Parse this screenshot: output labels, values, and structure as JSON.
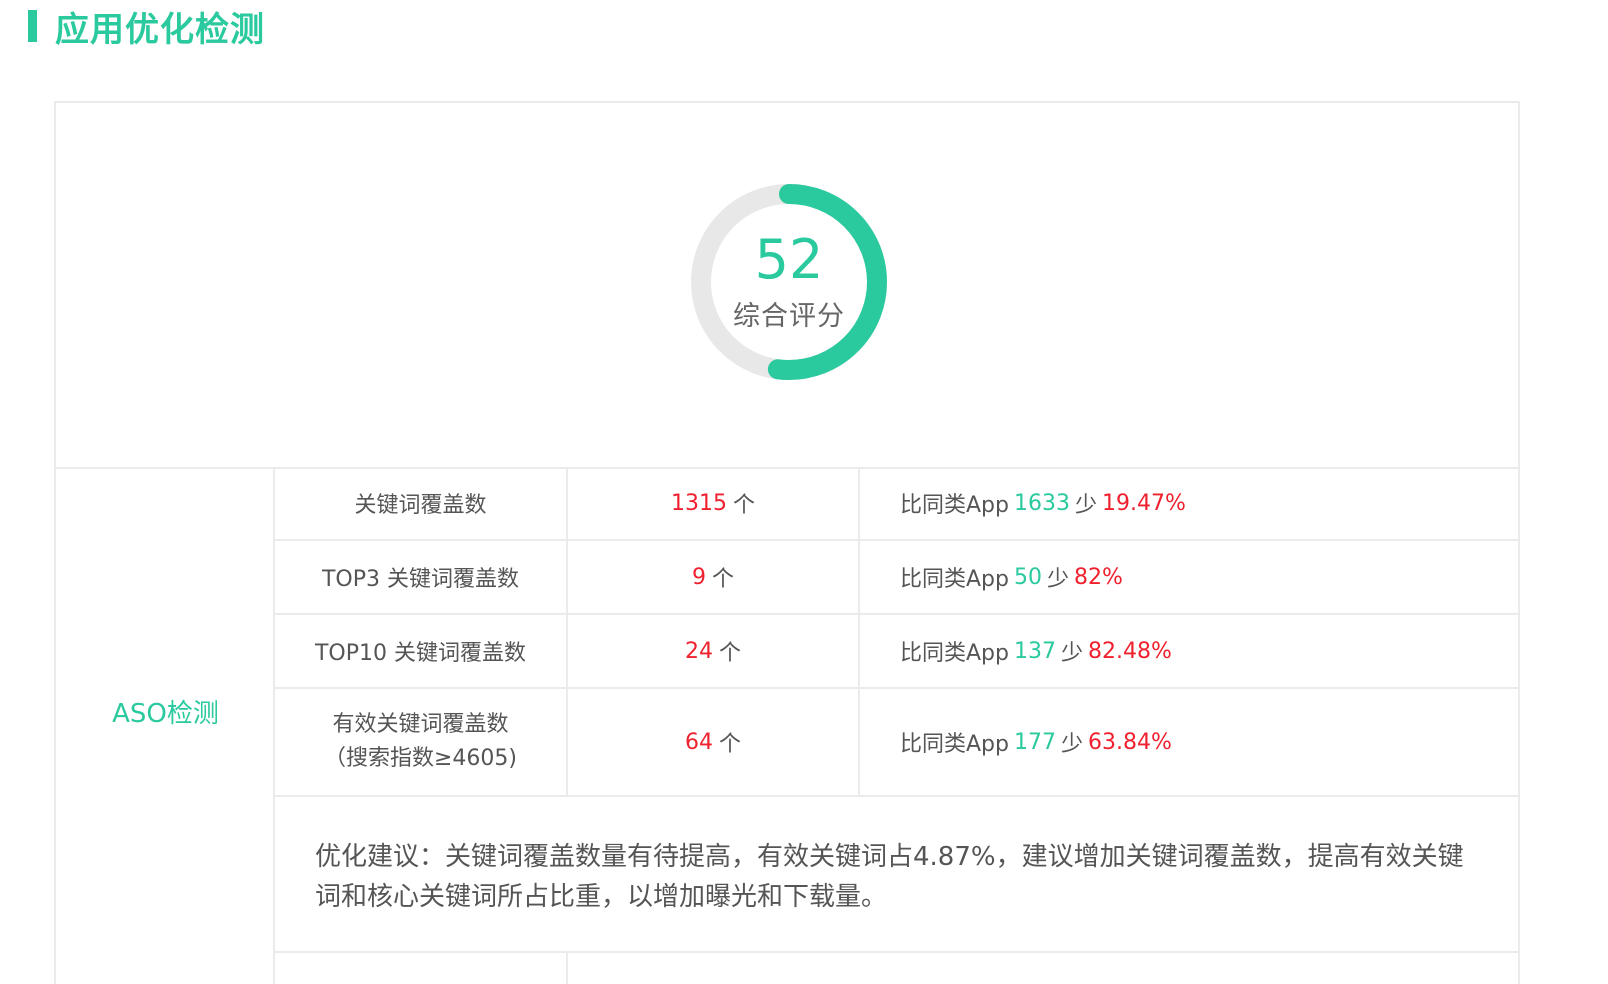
{
  "section": {
    "title": "应用优化检测",
    "accent_color": "#2ac99e"
  },
  "score": {
    "value": "52",
    "label": "综合评分",
    "fraction": 0.52,
    "track_color": "#e8e8e8",
    "fill_color": "#2ac99e"
  },
  "aso": {
    "label": "ASO检测",
    "rows": [
      {
        "name": "关键词覆盖数",
        "name_sub": "",
        "count": "1315",
        "unit": "个",
        "compare_prefix": "比同类App",
        "compare_value": "1633",
        "compare_word": "少",
        "compare_percent": "19.47%"
      },
      {
        "name": "TOP3 关键词覆盖数",
        "name_sub": "",
        "count": "9",
        "unit": "个",
        "compare_prefix": "比同类App",
        "compare_value": "50",
        "compare_word": "少",
        "compare_percent": "82%"
      },
      {
        "name": "TOP10 关键词覆盖数",
        "name_sub": "",
        "count": "24",
        "unit": "个",
        "compare_prefix": "比同类App",
        "compare_value": "137",
        "compare_word": "少",
        "compare_percent": "82.48%"
      },
      {
        "name": "有效关键词覆盖数",
        "name_sub": "（搜索指数≥4605)",
        "count": "64",
        "unit": "个",
        "compare_prefix": "比同类App",
        "compare_value": "177",
        "compare_word": "少",
        "compare_percent": "63.84%"
      }
    ],
    "advice": "优化建议：关键词覆盖数量有待提高，有效关键词占4.87%，建议增加关键词覆盖数，提高有效关键词和核心关键词所占比重，以增加曝光和下载量。"
  },
  "colors": {
    "red": "#f0212f",
    "green": "#2ac99e",
    "border": "#ebebeb"
  }
}
